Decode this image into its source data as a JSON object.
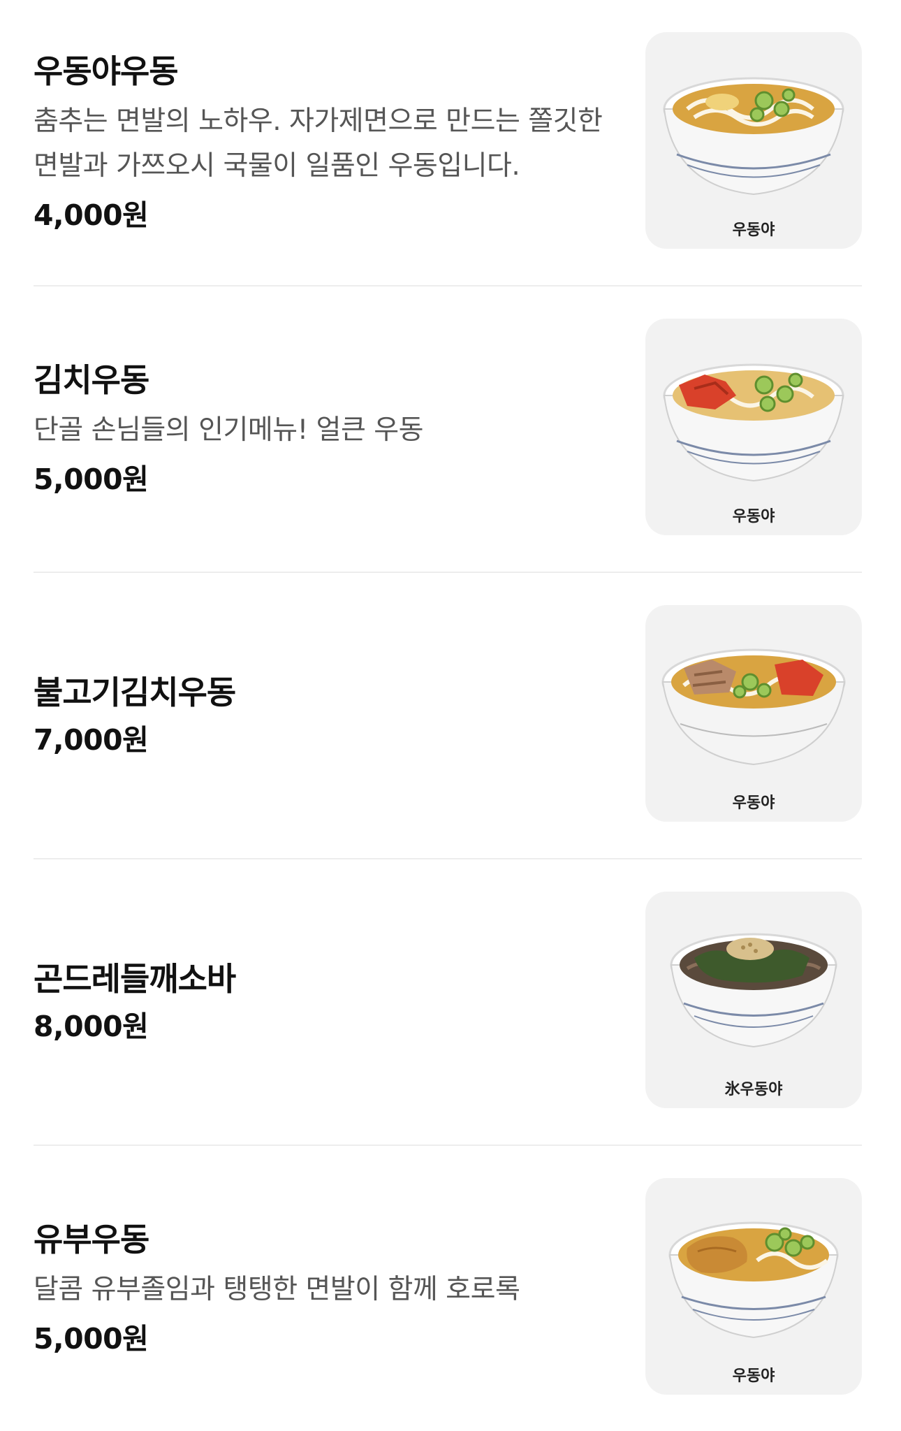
{
  "menu": {
    "items": [
      {
        "name": "우동야우동",
        "description": "춤추는 면발의 노하우. 자가제면으로 만드는 쫄깃한 면발과 가쯔오시 국물이 일품인 우동입니다.",
        "price": "4,000원",
        "logo": "우동야"
      },
      {
        "name": "김치우동",
        "description": "단골 손님들의 인기메뉴! 얼큰 우동",
        "price": "5,000원",
        "logo": "우동야"
      },
      {
        "name": "불고기김치우동",
        "description": "",
        "price": "7,000원",
        "logo": "우동야"
      },
      {
        "name": "곤드레들깨소바",
        "description": "",
        "price": "8,000원",
        "logo": "氷우동야"
      },
      {
        "name": "유부우동",
        "description": "달콤 유부졸임과 탱탱한 면발이 함께 호로록",
        "price": "5,000원",
        "logo": "우동야"
      }
    ]
  },
  "colors": {
    "broth": "#d9a441",
    "kimchi": "#d9412a",
    "beef": "#b98a6a",
    "greens": "#3e5a2c",
    "tofu": "#c98a35",
    "scallion": "#9cc85a"
  }
}
